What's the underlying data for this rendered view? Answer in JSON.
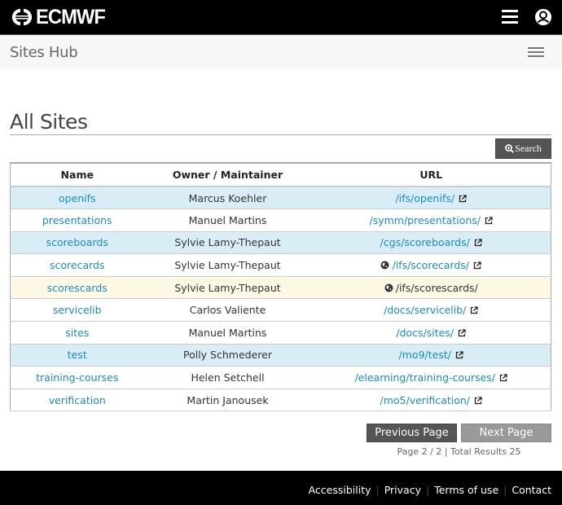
{
  "header": {
    "brand": "ECMWF",
    "app_title": "Sites Hub"
  },
  "icons": {
    "logo": "ecmwf-logo-icon",
    "top_menu": "hamburger-menu-icon",
    "user": "user-account-icon",
    "sub_menu": "hamburger-menu-icon",
    "search": "zoom-search-icon",
    "external": "external-link-icon",
    "globe": "globe-icon"
  },
  "main": {
    "page_title": "All Sites",
    "search_label": "Search"
  },
  "table": {
    "headers": [
      "Name",
      "Owner / Maintainer",
      "URL"
    ],
    "rows": [
      {
        "name": "openifs",
        "owner": "Marcus Koehler",
        "url": "/ifs/openifs/",
        "style": "info",
        "globe": false,
        "external": true,
        "url_link": true
      },
      {
        "name": "presentations",
        "owner": "Manuel Martins",
        "url": "/symm/presentations/",
        "style": "",
        "globe": false,
        "external": true,
        "url_link": true
      },
      {
        "name": "scoreboards",
        "owner": "Sylvie Lamy-Thepaut",
        "url": "/cgs/scoreboards/",
        "style": "info",
        "globe": false,
        "external": true,
        "url_link": true
      },
      {
        "name": "scorecards",
        "owner": "Sylvie Lamy-Thepaut",
        "url": "/ifs/scorecards/",
        "style": "",
        "globe": true,
        "external": true,
        "url_link": true
      },
      {
        "name": "scorescards",
        "owner": "Sylvie Lamy-Thepaut",
        "url": "/ifs/scorescards/",
        "style": "warning",
        "globe": true,
        "external": false,
        "url_link": false
      },
      {
        "name": "servicelib",
        "owner": "Carlos Valiente",
        "url": "/docs/servicelib/",
        "style": "",
        "globe": false,
        "external": true,
        "url_link": true
      },
      {
        "name": "sites",
        "owner": "Manuel Martins",
        "url": "/docs/sites/",
        "style": "",
        "globe": false,
        "external": true,
        "url_link": true
      },
      {
        "name": "test",
        "owner": "Polly Schmederer",
        "url": "/mo9/test/",
        "style": "info",
        "globe": false,
        "external": true,
        "url_link": true
      },
      {
        "name": "training-courses",
        "owner": "Helen Setchell",
        "url": "/elearning/training-courses/",
        "style": "",
        "globe": false,
        "external": true,
        "url_link": true
      },
      {
        "name": "verification",
        "owner": "Martin Janousek",
        "url": "/mo5/verification/",
        "style": "",
        "globe": false,
        "external": true,
        "url_link": true
      }
    ]
  },
  "pagination": {
    "previous_label": "Previous Page",
    "next_label": "Next Page",
    "info": "Page 2 / 2 | Total Results 25",
    "current_page": 2,
    "total_pages": 2,
    "total_results": 25
  },
  "footer": {
    "links": [
      "Accessibility",
      "Privacy",
      "Terms of use",
      "Contact"
    ]
  },
  "colors": {
    "link": "#1a8ac6",
    "info_row": "#d9edf7",
    "warning_row": "#fcf8e3",
    "topbar": "#000000",
    "button_dark": "#555555",
    "button_disabled": "#999999"
  }
}
